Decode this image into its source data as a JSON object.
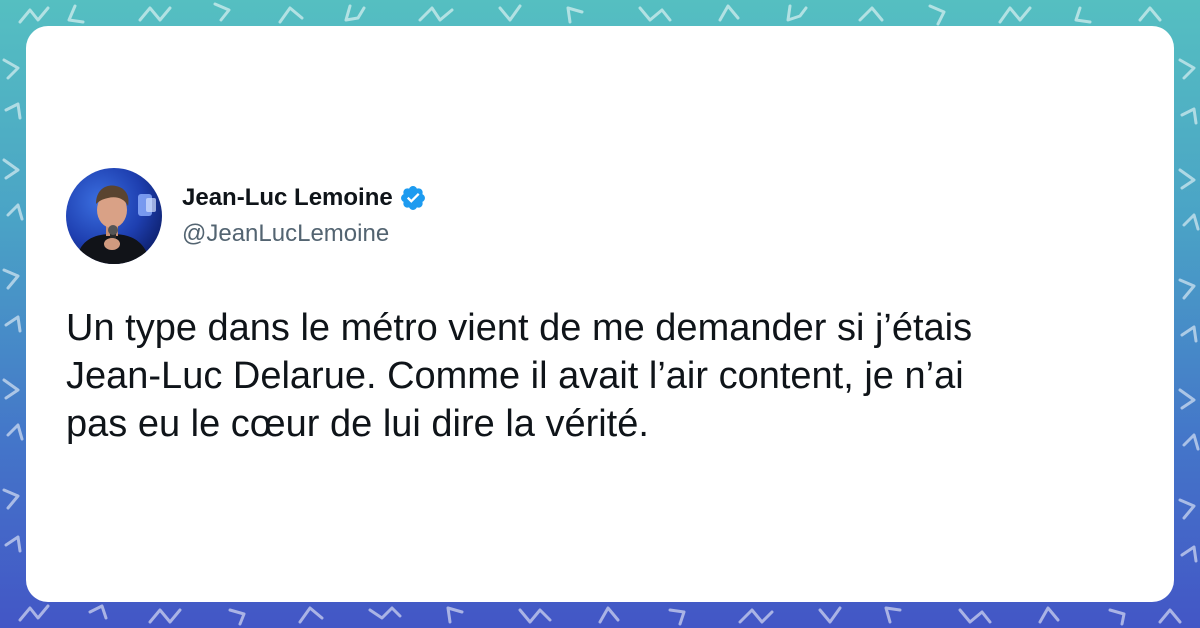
{
  "tweet": {
    "author_name": "Jean-Luc Lemoine",
    "handle": "@JeanLucLemoine",
    "verified": true,
    "text_lines": [
      "Un type dans le métro vient de me demander si j’étais",
      "Jean-Luc Delarue. Comme il avait l’air content, je n’ai",
      "pas eu le cœur de lui dire la vérité."
    ]
  },
  "icons": {
    "verified": "verified-badge-icon",
    "avatar": "profile-photo"
  },
  "colors": {
    "background_top": "#55bfc1",
    "background_bottom": "#4356c6",
    "card": "#ffffff",
    "text": "#0f1419",
    "handle": "#536471",
    "verified": "#1d9bf0"
  }
}
